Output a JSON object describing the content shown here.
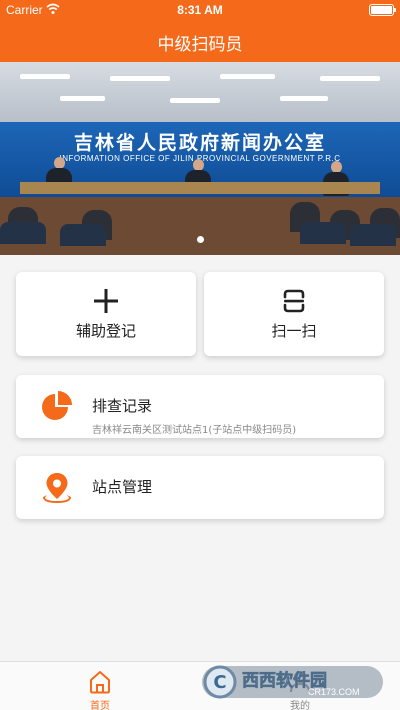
{
  "status_bar": {
    "carrier": "Carrier",
    "time": "8:31 AM"
  },
  "header": {
    "title": "中级扫码员"
  },
  "banner": {
    "wall_text": "吉林省人民政府新闻办公室",
    "wall_text_en": "INFORMATION OFFICE OF JILIN PROVINCIAL GOVERNMENT P.R.C"
  },
  "actions": {
    "assist_register": {
      "label": "辅助登记",
      "icon": "plus-icon"
    },
    "scan": {
      "label": "扫一扫",
      "icon": "scan-icon"
    }
  },
  "menu": {
    "records": {
      "label": "排查记录",
      "subtitle": "吉林祥云南关区测试站点1(子站点中级扫码员)",
      "icon": "pie-chart-icon"
    },
    "station": {
      "label": "站点管理",
      "icon": "location-pin-icon"
    }
  },
  "tabs": [
    {
      "label": "首页",
      "icon": "home-icon",
      "active": true
    },
    {
      "label": "我的",
      "icon": "person-icon",
      "active": false
    }
  ],
  "watermark": {
    "text": "西西软件园",
    "url_text": "CR173.COM"
  },
  "colors": {
    "accent": "#f56a1a",
    "tab_inactive": "#888888"
  }
}
